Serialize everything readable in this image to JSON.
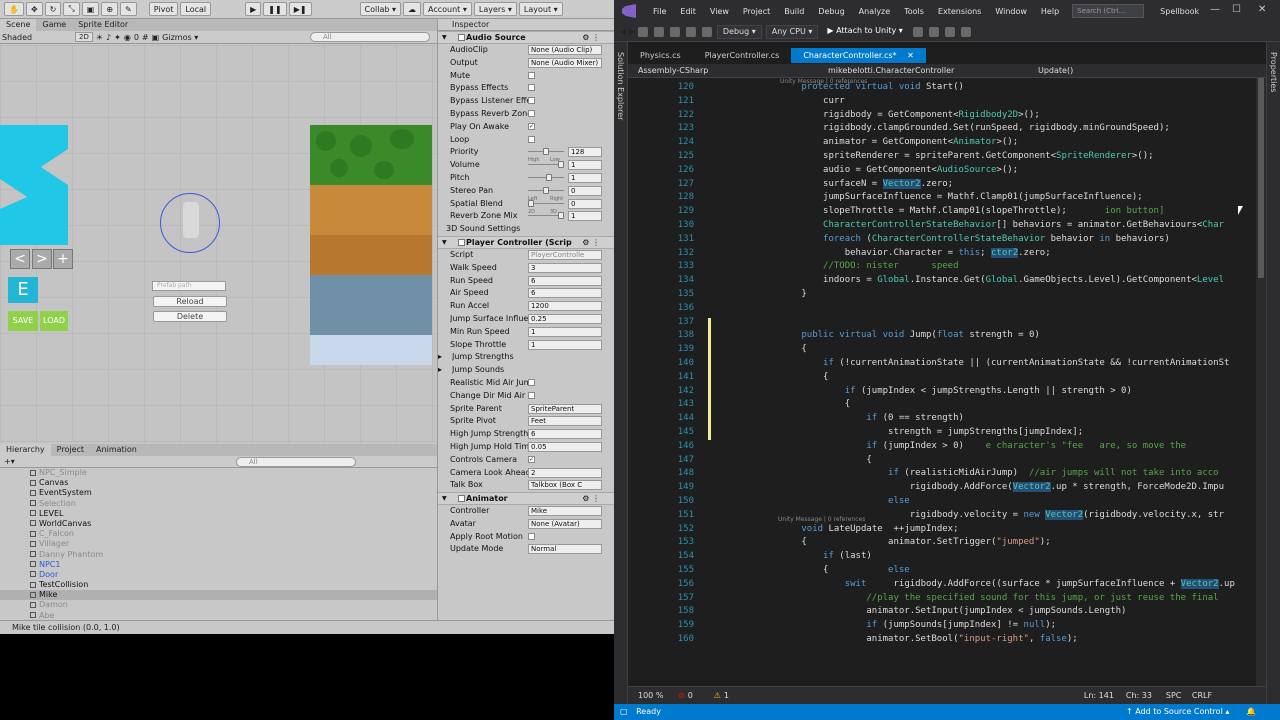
{
  "unity": {
    "toolbar": {
      "pivot": "Pivot",
      "local": "Local",
      "collab": "Collab ▾",
      "account": "Account ▾",
      "layers": "Layers ▾",
      "layout": "Layout ▾"
    },
    "scene_tabs": [
      "Scene",
      "Game",
      "Sprite Editor"
    ],
    "scene_bar": {
      "shading": "Shaded",
      "mode_2d": "2D",
      "gizmos": "Gizmos ▾",
      "search_placeholder": "All",
      "zero": "0"
    },
    "scene": {
      "prefab_placeholder": "Prefab path",
      "reload": "Reload",
      "delete": "Delete",
      "save": "SAVE",
      "load": "LOAD",
      "e_key": "E",
      "arrows": [
        "<",
        ">",
        "+"
      ]
    },
    "hierarchy_tabs": [
      "Hierarchy",
      "Project",
      "Animation"
    ],
    "hierarchy_search": "All",
    "hierarchy": [
      {
        "label": "NPC_Simple",
        "style": "dim"
      },
      {
        "label": "Canvas",
        "style": ""
      },
      {
        "label": "EventSystem",
        "style": ""
      },
      {
        "label": "Selection",
        "style": "dim"
      },
      {
        "label": "LEVEL",
        "style": ""
      },
      {
        "label": "WorldCanvas",
        "style": ""
      },
      {
        "label": "C_Falcon",
        "style": "dim"
      },
      {
        "label": "Villager",
        "style": "dim"
      },
      {
        "label": "Danny Phantom",
        "style": "dim"
      },
      {
        "label": "NPC1",
        "style": "blue"
      },
      {
        "label": "Door",
        "style": "blue"
      },
      {
        "label": "TestCollision",
        "style": ""
      },
      {
        "label": "Mike",
        "style": "sel"
      },
      {
        "label": "Damon",
        "style": "dim"
      },
      {
        "label": "Abe",
        "style": "dim"
      }
    ],
    "status": "Mike tile collision (0.0, 1.0)",
    "inspector": {
      "tab": "Inspector",
      "audio_source": {
        "title": "Audio Source",
        "props": [
          {
            "label": "AudioClip",
            "type": "field",
            "value": "None (Audio Clip)"
          },
          {
            "label": "Output",
            "type": "field",
            "value": "None (Audio Mixer)"
          },
          {
            "label": "Mute",
            "type": "check",
            "value": ""
          },
          {
            "label": "Bypass Effects",
            "type": "check",
            "value": ""
          },
          {
            "label": "Bypass Listener Effec",
            "type": "check",
            "value": ""
          },
          {
            "label": "Bypass Reverb Zones",
            "type": "check",
            "value": ""
          },
          {
            "label": "Play On Awake",
            "type": "check",
            "value": "✓"
          },
          {
            "label": "Loop",
            "type": "check",
            "value": ""
          }
        ],
        "sliders": [
          {
            "label": "Priority",
            "value": "128",
            "level": 0.5,
            "low": "High",
            "high": "Low"
          },
          {
            "label": "Volume",
            "value": "1",
            "level": 1
          },
          {
            "label": "Pitch",
            "value": "1",
            "level": 0.6
          },
          {
            "label": "Stereo Pan",
            "value": "0",
            "level": 0.5,
            "low": "Left",
            "high": "Right"
          },
          {
            "label": "Spatial Blend",
            "value": "0",
            "level": 0,
            "low": "2D",
            "high": "3D"
          },
          {
            "label": "Reverb Zone Mix",
            "value": "1",
            "level": 1
          }
        ],
        "settings": "3D Sound Settings"
      },
      "player_controller": {
        "title": "Player Controller (Scrip",
        "props": [
          {
            "label": "Script",
            "type": "field",
            "value": "PlayerControlle",
            "dim": true
          },
          {
            "label": "Walk Speed",
            "type": "field",
            "value": "3"
          },
          {
            "label": "Run Speed",
            "type": "field",
            "value": "6"
          },
          {
            "label": "Air Speed",
            "type": "field",
            "value": "6"
          },
          {
            "label": "Run Accel",
            "type": "field",
            "value": "1200"
          },
          {
            "label": "Jump Surface Influen",
            "type": "field",
            "value": "0.25"
          },
          {
            "label": "Min Run Speed",
            "type": "field",
            "value": "1"
          },
          {
            "label": "Slope Throttle",
            "type": "field",
            "value": "1"
          },
          {
            "label": "Jump Strengths",
            "type": "fold",
            "value": ""
          },
          {
            "label": "Jump Sounds",
            "type": "fold",
            "value": ""
          },
          {
            "label": "Realistic Mid Air Jump",
            "type": "check",
            "value": ""
          },
          {
            "label": "Change Dir Mid Air",
            "type": "check",
            "value": ""
          },
          {
            "label": "Sprite Parent",
            "type": "field",
            "value": "SpriteParent"
          },
          {
            "label": "Sprite Pivot",
            "type": "field",
            "value": "Feet"
          },
          {
            "label": "High Jump Strength",
            "type": "field",
            "value": "6"
          },
          {
            "label": "High Jump Hold Time",
            "type": "field",
            "value": "0.05"
          },
          {
            "label": "Controls Camera",
            "type": "check",
            "value": "✓"
          },
          {
            "label": "Camera Look Ahead I",
            "type": "field",
            "value": "2"
          },
          {
            "label": "Talk Box",
            "type": "field",
            "value": "Talkbox (Box C"
          }
        ]
      },
      "animator": {
        "title": "Animator",
        "props": [
          {
            "label": "Controller",
            "type": "field",
            "value": "Mike"
          },
          {
            "label": "Avatar",
            "type": "field",
            "value": "None (Avatar)"
          },
          {
            "label": "Apply Root Motion",
            "type": "check",
            "value": ""
          },
          {
            "label": "Update Mode",
            "type": "field",
            "value": "Normal"
          }
        ]
      }
    }
  },
  "vs": {
    "menu": [
      "File",
      "Edit",
      "View",
      "Project",
      "Build",
      "Debug",
      "Analyze",
      "Tools",
      "Extensions",
      "Window",
      "Help"
    ],
    "search_placeholder": "Search (Ctrl...",
    "solution": "Spellbook",
    "toolbar": {
      "config": "Debug ▾",
      "platform": "Any CPU ▾",
      "attach": "▶ Attach to Unity ▾"
    },
    "tabs": [
      "Physics.cs",
      "PlayerController.cs",
      "CharacterController.cs*"
    ],
    "nav": {
      "project": "Assembly-CSharp",
      "class": "mikebelotti.CharacterController",
      "member": "Update()"
    },
    "side_left": "Solution Explorer",
    "side_right": "Properties",
    "line_numbers": [
      "120",
      "121",
      "122",
      "123",
      "124",
      "125",
      "126",
      "127",
      "128",
      "129",
      "130",
      "131",
      "132",
      "133",
      "134",
      "135",
      "136",
      "137",
      "138",
      "139",
      "140",
      "141",
      "142",
      "143",
      "144",
      "145",
      "146",
      "147",
      "148",
      "149",
      "150",
      "151",
      "152",
      "153",
      "154",
      "155",
      "156",
      "157",
      "158",
      "159",
      "160"
    ],
    "lens": [
      "Unity Message | 0 references",
      "Unity Message | 0 references"
    ],
    "code": [
      [
        {
          "t": "        "
        },
        {
          "t": "protected virtual void ",
          "c": "kw"
        },
        {
          "t": "Start()"
        }
      ],
      [
        {
          "t": "            curr"
        }
      ],
      [
        {
          "t": "            rigidbody = GetComponent<"
        },
        {
          "t": "Rigidbody2D",
          "c": "ty"
        },
        {
          "t": ">();"
        }
      ],
      [
        {
          "t": "            rigidbody.clampGrounded.Set(runSpeed, rigidbody.minGroundSpeed);"
        }
      ],
      [
        {
          "t": "            animator = GetComponent<"
        },
        {
          "t": "Animator",
          "c": "ty"
        },
        {
          "t": ">();"
        }
      ],
      [
        {
          "t": "            spriteRenderer = spritePa"
        },
        {
          "t": "rent.GetComponent<"
        },
        {
          "t": "SpriteRenderer",
          "c": "ty"
        },
        {
          "t": ">();"
        }
      ],
      [
        {
          "t": "            audio = GetComponent<"
        },
        {
          "t": "AudioSource",
          "c": "ty"
        },
        {
          "t": ">();"
        }
      ],
      [
        {
          "t": "            surfaceN = "
        },
        {
          "t": "Vector2",
          "c": "ty hl"
        },
        {
          "t": ".zero;"
        }
      ],
      [
        {
          "t": "            jumpSurfaceInfluence = Mathf.Clamp01(jumpSurfaceInfluence);"
        }
      ],
      [
        {
          "t": "            slopeThrottle = Mathf.Clamp01(slopeThrottle);"
        },
        {
          "t": "       ion button]",
          "c": "cm"
        }
      ],
      [
        {
          "t": "            "
        },
        {
          "t": "CharacterControllerStateBehavior",
          "c": "ty"
        },
        {
          "t": "[] behaviors = animator.GetBehaviours<"
        },
        {
          "t": "Char",
          "c": "ty"
        }
      ],
      [
        {
          "t": "            "
        },
        {
          "t": "foreach",
          "c": "kw"
        },
        {
          "t": " ("
        },
        {
          "t": "CharacterControllerStateBehavior",
          "c": "ty"
        },
        {
          "t": " behavior "
        },
        {
          "t": "in",
          "c": "kw"
        },
        {
          "t": " behaviors)"
        }
      ],
      [
        {
          "t": "                behavior.Character = "
        },
        {
          "t": "this",
          "c": "kw"
        },
        {
          "t": "; "
        },
        {
          "t": "ctor2",
          "c": "ty hl"
        },
        {
          "t": ".zero;"
        }
      ],
      [
        {
          "t": "            "
        },
        {
          "t": "//TODO: nister      speed",
          "c": "cm"
        }
      ],
      [
        {
          "t": "            indoors = "
        },
        {
          "t": "Global",
          "c": "ty"
        },
        {
          "t": ".Instance.Get("
        },
        {
          "t": "Global",
          "c": "ty"
        },
        {
          "t": ".GameObjects.Level).GetComponent<"
        },
        {
          "t": "Level",
          "c": "ty"
        }
      ],
      [
        {
          "t": "        }"
        }
      ],
      [
        {
          "t": ""
        }
      ],
      [
        {
          "t": ""
        }
      ],
      [
        {
          "t": "        "
        },
        {
          "t": "public virtual void ",
          "c": "kw"
        },
        {
          "t": "Jump("
        },
        {
          "t": "float",
          "c": "kw"
        },
        {
          "t": " strength = 0)"
        }
      ],
      [
        {
          "t": "        {"
        }
      ],
      [
        {
          "t": "            "
        },
        {
          "t": "if",
          "c": "kw"
        },
        {
          "t": " (!currentAnimationState || (currentAnimationState && !currentAnimationSt"
        }
      ],
      [
        {
          "t": "            {"
        }
      ],
      [
        {
          "t": "                "
        },
        {
          "t": "if",
          "c": "kw"
        },
        {
          "t": " (jumpIndex < jumpStrengths.Length || strength > 0)"
        }
      ],
      [
        {
          "t": "                {"
        }
      ],
      [
        {
          "t": "                    "
        },
        {
          "t": "if",
          "c": "kw"
        },
        {
          "t": " (0 == strength)"
        }
      ],
      [
        {
          "t": "                        strength = jumpStrengths[jumpIndex];"
        }
      ],
      [
        {
          "t": "                    "
        },
        {
          "t": "if",
          "c": "kw"
        },
        {
          "t": " (jumpIndex > 0)"
        },
        {
          "t": "    e character's \"fee   are, so move the",
          "c": "cm"
        }
      ],
      [
        {
          "t": "                    {"
        }
      ],
      [
        {
          "t": "                        "
        },
        {
          "t": "if",
          "c": "kw"
        },
        {
          "t": " (realisticMidAirJump)  "
        },
        {
          "t": "//air jumps will not take into acco",
          "c": "cm"
        }
      ],
      [
        {
          "t": "                            rigidbody.AddForce("
        },
        {
          "t": "Vector2",
          "c": "ty hl"
        },
        {
          "t": ".up * strength, ForceMode2D.Impu"
        }
      ],
      [
        {
          "t": "                        "
        },
        {
          "t": "else",
          "c": "kw"
        }
      ],
      [
        {
          "t": "                            rigidbody.velocity = "
        },
        {
          "t": "new ",
          "c": "kw"
        },
        {
          "t": "Vector2",
          "c": "ty hl"
        },
        {
          "t": "(rigidbody.velocity.x, str"
        }
      ],
      [
        {
          "t": "        "
        },
        {
          "t": "void",
          "c": "kw"
        },
        {
          "t": " LateUpdate  ++jumpIndex;"
        }
      ],
      [
        {
          "t": "        {               animator.SetTrigger("
        },
        {
          "t": "\"jumped\"",
          "c": "st"
        },
        {
          "t": ");"
        }
      ],
      [
        {
          "t": "            "
        },
        {
          "t": "if",
          "c": "kw"
        },
        {
          "t": " (last)"
        }
      ],
      [
        {
          "t": "            {           "
        },
        {
          "t": "else",
          "c": "kw"
        }
      ],
      [
        {
          "t": "                "
        },
        {
          "t": "swit",
          "c": "kw"
        },
        {
          "t": "     rigidbody.AddForce((surface * jumpSurfaceInfluence + "
        },
        {
          "t": "Vector2",
          "c": "ty hl"
        },
        {
          "t": ".up"
        }
      ],
      [
        {
          "t": "                    "
        },
        {
          "t": "//play the specified sound for this jump, or just reuse the final",
          "c": "cm"
        }
      ],
      [
        {
          "t": "                    animator.SetInput(jumpIndex < jumpSounds.Length)"
        }
      ],
      [
        {
          "t": "                    "
        },
        {
          "t": "if",
          "c": "kw"
        },
        {
          "t": " (jumpSounds[jumpIndex] != "
        },
        {
          "t": "null",
          "c": "kw"
        },
        {
          "t": ");"
        }
      ],
      [
        {
          "t": "                    animator.SetBool("
        },
        {
          "t": "\"input-right\"",
          "c": "st"
        },
        {
          "t": ", "
        },
        {
          "t": "false",
          "c": "kw"
        },
        {
          "t": ");"
        }
      ]
    ],
    "bottom": {
      "zoom": "100 %",
      "errors": "0",
      "warnings": "1",
      "line": "Ln: 141",
      "col": "Ch: 33",
      "spc": "SPC",
      "crlf": "CRLF"
    },
    "status": {
      "ready": "Ready",
      "source_control": "↑ Add to Source Control ▴"
    }
  }
}
